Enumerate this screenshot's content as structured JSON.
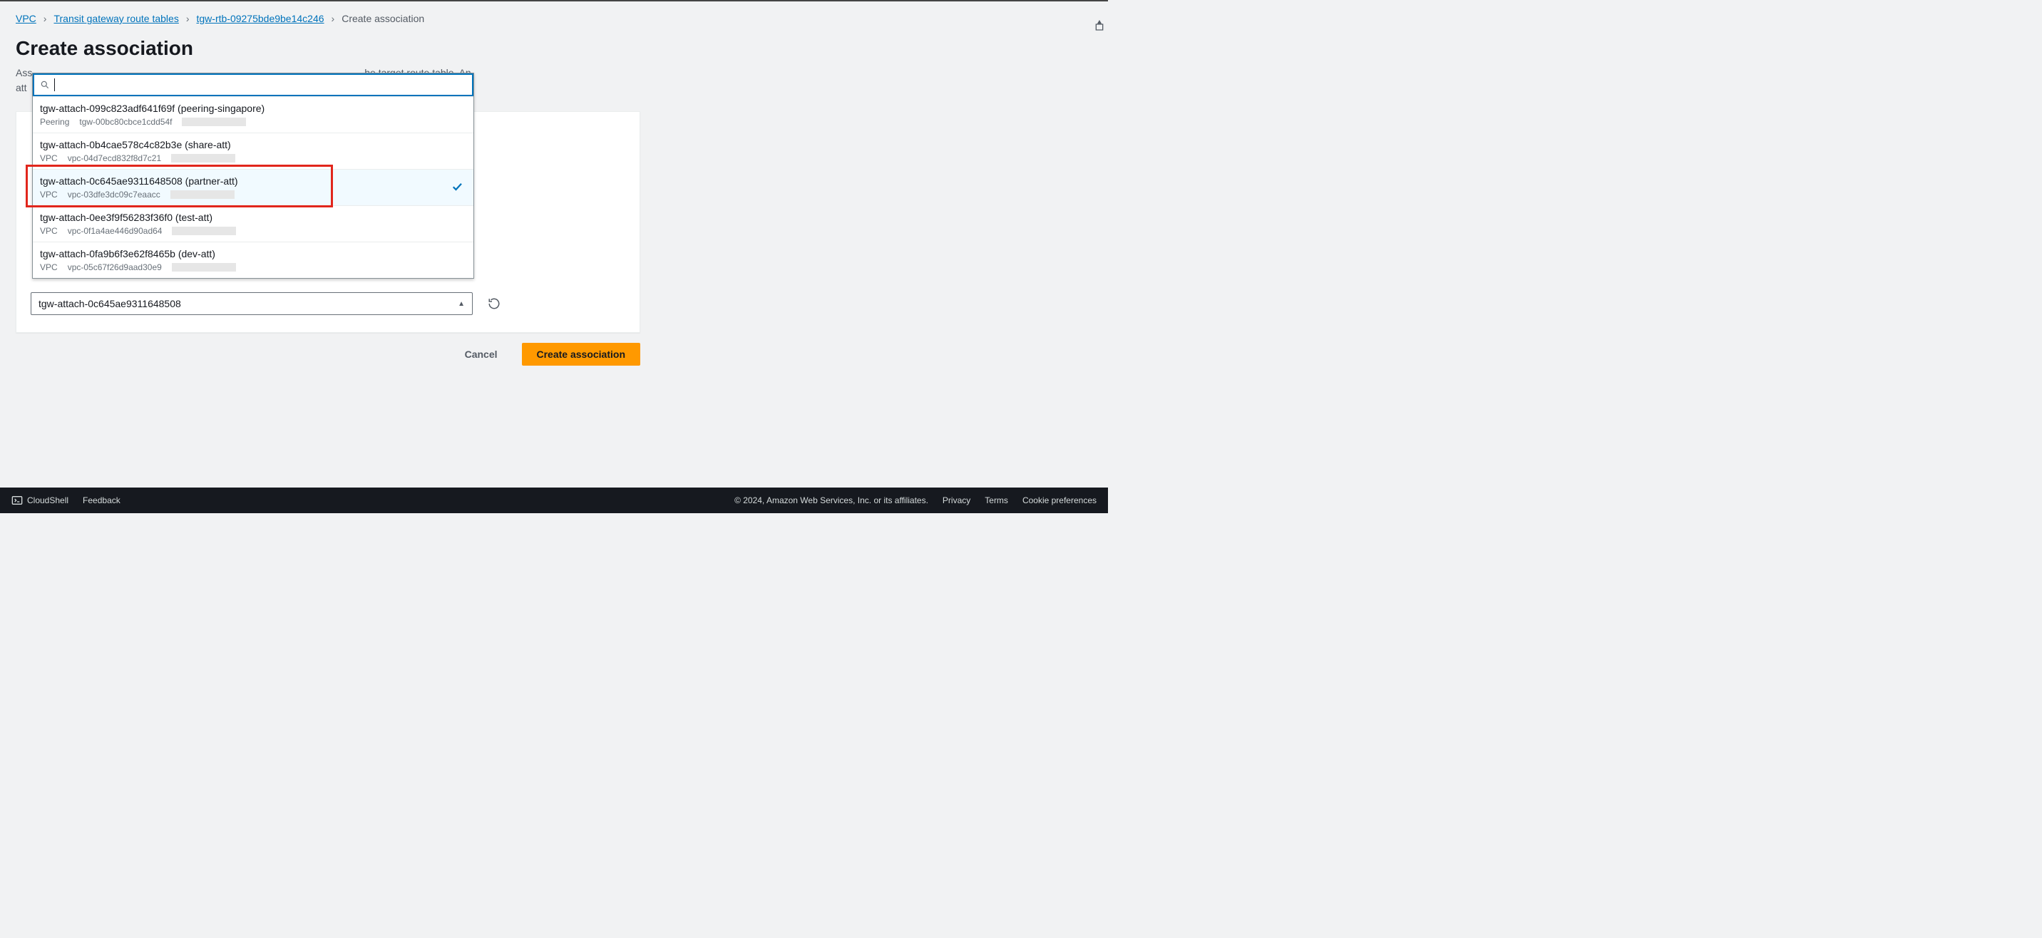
{
  "breadcrumb": {
    "vpc": "VPC",
    "tgw_tables": "Transit gateway route tables",
    "rtb_id": "tgw-rtb-09275bde9be14c246",
    "current": "Create association"
  },
  "page": {
    "title": "Create association",
    "desc_visible_right": "he target route table. An",
    "desc_full_line1": "Associate an attachment to a route table. Each attachment routes traffic using the target route table. An",
    "desc_visible_left_prefix": "Ass",
    "desc_second_line_prefix": "att"
  },
  "search": {
    "placeholder": ""
  },
  "options": [
    {
      "title": "tgw-attach-099c823adf641f69f (peering-singapore)",
      "kind": "Peering",
      "sub": "tgw-00bc80cbce1cdd54f",
      "selected": false
    },
    {
      "title": "tgw-attach-0b4cae578c4c82b3e (share-att)",
      "kind": "VPC",
      "sub": "vpc-04d7ecd832f8d7c21",
      "selected": false
    },
    {
      "title": "tgw-attach-0c645ae9311648508 (partner-att)",
      "kind": "VPC",
      "sub": "vpc-03dfe3dc09c7eaacc",
      "selected": true
    },
    {
      "title": "tgw-attach-0ee3f9f56283f36f0 (test-att)",
      "kind": "VPC",
      "sub": "vpc-0f1a4ae446d90ad64",
      "selected": false
    },
    {
      "title": "tgw-attach-0fa9b6f3e62f8465b (dev-att)",
      "kind": "VPC",
      "sub": "vpc-05c67f26d9aad30e9",
      "selected": false
    }
  ],
  "select": {
    "value": "tgw-attach-0c645ae9311648508"
  },
  "actions": {
    "cancel": "Cancel",
    "submit": "Create association"
  },
  "footer": {
    "cloudshell": "CloudShell",
    "feedback": "Feedback",
    "copyright": "© 2024, Amazon Web Services, Inc. or its affiliates.",
    "privacy": "Privacy",
    "terms": "Terms",
    "cookies": "Cookie preferences"
  }
}
